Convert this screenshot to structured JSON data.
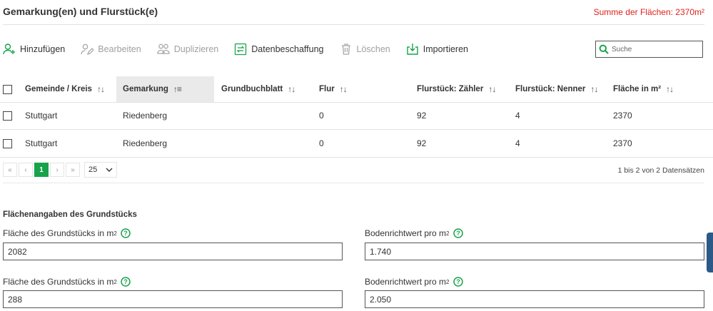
{
  "header": {
    "title": "Gemarkung(en) und Flurstück(e)",
    "sum_label": "Summe der Flächen: 2370m²"
  },
  "toolbar": {
    "add": "Hinzufügen",
    "edit": "Bearbeiten",
    "duplicate": "Duplizieren",
    "data_procurement": "Datenbeschaffung",
    "delete": "Löschen",
    "import": "Importieren"
  },
  "search": {
    "placeholder": "Suche",
    "value": ""
  },
  "table": {
    "columns": [
      "Gemeinde / Kreis",
      "Gemarkung",
      "Grundbuchblatt",
      "Flur",
      "Flurstück: Zähler",
      "Flurstück: Nenner",
      "Fläche in m²"
    ],
    "rows": [
      [
        "Stuttgart",
        "Riedenberg",
        "",
        "0",
        "92",
        "4",
        "2370"
      ],
      [
        "Stuttgart",
        "Riedenberg",
        "",
        "0",
        "92",
        "4",
        "2370"
      ]
    ]
  },
  "pager": {
    "first": "«",
    "prev": "‹",
    "current_page": "1",
    "next": "›",
    "last": "»",
    "page_size": "25",
    "records_info": "1 bis 2 von 2 Datensätzen"
  },
  "areas": {
    "section_title": "Flächenangaben des Grundstücks",
    "rows": [
      {
        "area_label": "Fläche des Grundstücks in m",
        "area_value": "2082",
        "value_label": "Bodenrichtwert pro m",
        "value_value": "1.740"
      },
      {
        "area_label": "Fläche des Grundstücks in m",
        "area_value": "288",
        "value_label": "Bodenrichtwert pro m",
        "value_value": "2.050"
      }
    ],
    "sup": "2"
  },
  "colors": {
    "accent_green": "#17a34a",
    "sum_red": "#e0201b",
    "side_tab_blue": "#2c5a88"
  },
  "icons": [
    "add-user-icon",
    "edit-icon",
    "duplicate-icon",
    "data-procurement-icon",
    "trash-icon",
    "import-icon",
    "search-icon",
    "sort-icon",
    "sort-ascending-icon",
    "help-icon",
    "chevron-down-icon"
  ]
}
